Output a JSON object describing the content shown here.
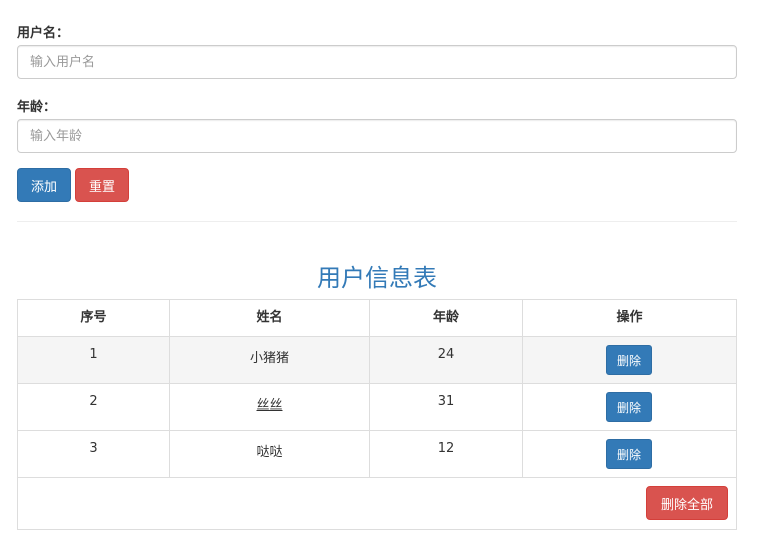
{
  "form": {
    "username_label": "用户名：",
    "username_placeholder": "输入用户名",
    "username_value": "",
    "age_label": "年龄：",
    "age_placeholder": "输入年龄",
    "age_value": "",
    "add_label": "添加",
    "reset_label": "重置"
  },
  "table": {
    "title": "用户信息表",
    "headers": [
      "序号",
      "姓名",
      "年龄",
      "操作"
    ],
    "rows": [
      {
        "index": "1",
        "name": "小猪猪",
        "age": "24",
        "action": "删除"
      },
      {
        "index": "2",
        "name": "丝丝",
        "age": "31",
        "action": "删除"
      },
      {
        "index": "3",
        "name": "哒哒",
        "age": "12",
        "action": "删除"
      }
    ],
    "delete_all_label": "删除全部"
  },
  "colors": {
    "primary": "#337ab7",
    "danger": "#d9534f",
    "stripe": "#f5f5f5"
  }
}
